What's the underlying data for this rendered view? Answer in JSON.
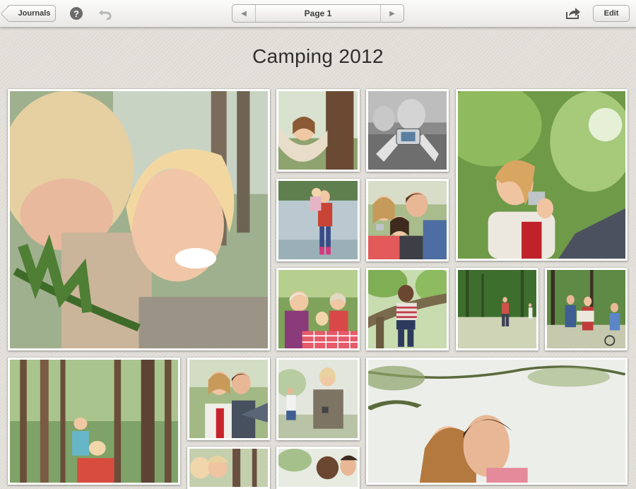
{
  "toolbar": {
    "back_label": "Journals",
    "help_icon": "help-icon",
    "help_glyph": "?",
    "undo_icon": "undo-icon",
    "pager": {
      "prev_glyph": "◀",
      "label": "Page 1",
      "next_glyph": "▶"
    },
    "share_icon": "share-icon",
    "edit_label": "Edit"
  },
  "journal": {
    "title": "Camping 2012"
  },
  "photos": [
    {
      "name": "photo-boy-laughing-with-mother",
      "scene": "boy-portrait"
    },
    {
      "name": "photo-girl-in-hammock",
      "scene": "hammock"
    },
    {
      "name": "photo-hands-holding-camera",
      "scene": "camera-bw"
    },
    {
      "name": "photo-woman-with-camera",
      "scene": "woman-camera"
    },
    {
      "name": "photo-father-and-child-at-lake",
      "scene": "lake"
    },
    {
      "name": "photo-family-selfie",
      "scene": "selfie"
    },
    {
      "name": "photo-grandparents-picnic",
      "scene": "picnic"
    },
    {
      "name": "photo-boy-on-tree",
      "scene": "tree-boy"
    },
    {
      "name": "photo-throwing-in-meadow",
      "scene": "meadow"
    },
    {
      "name": "photo-family-reading-map",
      "scene": "map"
    },
    {
      "name": "photo-family-walking-in-forest",
      "scene": "forest-walk"
    },
    {
      "name": "photo-couple-smiling",
      "scene": "couple-small"
    },
    {
      "name": "photo-woman-seated-outdoors",
      "scene": "woman-seated"
    },
    {
      "name": "photo-couple-portrait-under-tree",
      "scene": "couple-large"
    },
    {
      "name": "photo-children-bottom-left",
      "scene": "kids-partial"
    },
    {
      "name": "photo-children-bottom-middle",
      "scene": "kids-partial-2"
    }
  ]
}
